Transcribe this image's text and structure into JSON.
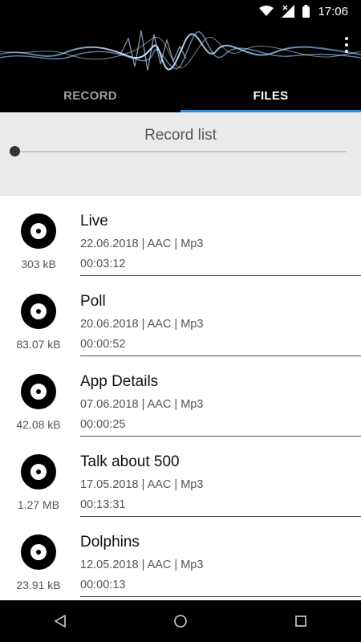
{
  "status_bar": {
    "time": "17:06"
  },
  "tabs": [
    {
      "label": "RECORD",
      "active": false
    },
    {
      "label": "FILES",
      "active": true
    }
  ],
  "record_panel": {
    "title": "Record list",
    "position_fraction": 0
  },
  "records": [
    {
      "name": "Live",
      "meta": "22.06.2018 | AAC | Mp3",
      "duration": "00:03:12",
      "size": "303 kB"
    },
    {
      "name": "Poll",
      "meta": "20.06.2018 | AAC | Mp3",
      "duration": "00:00:52",
      "size": "83.07 kB"
    },
    {
      "name": "App Details",
      "meta": "07.06.2018 | AAC | Mp3",
      "duration": "00:00:25",
      "size": "42.08 kB"
    },
    {
      "name": "Talk about 500",
      "meta": "17.05.2018 | AAC | Mp3",
      "duration": "00:13:31",
      "size": "1.27 MB"
    },
    {
      "name": "Dolphins",
      "meta": "12.05.2018 | AAC | Mp3",
      "duration": "00:00:13",
      "size": "23.91 kB"
    }
  ],
  "colors": {
    "tab_indicator": "#2e8fe0",
    "header_bg": "#000000",
    "panel_bg": "#e9ebea"
  }
}
